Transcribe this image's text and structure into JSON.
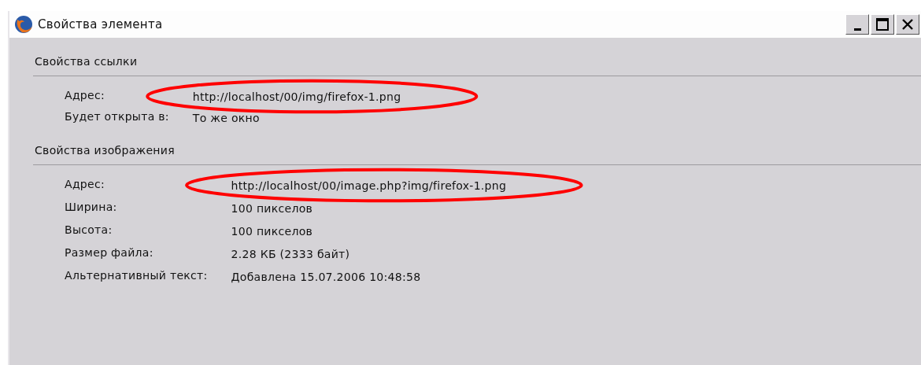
{
  "window": {
    "title": "Свойства элемента"
  },
  "sections": [
    {
      "title": "Свойства ссылки",
      "rows": [
        {
          "label": "Адрес:",
          "value": "http://localhost/00/img/firefox-1.png",
          "circled": true
        },
        {
          "label": "Будет открыта в:",
          "value": "То же окно",
          "circled": false
        }
      ]
    },
    {
      "title": "Свойства изображения",
      "rows": [
        {
          "label": "Адрес:",
          "value": "http://localhost/00/image.php?img/firefox-1.png",
          "circled": true
        },
        {
          "label": "Ширина:",
          "value": "100 пикселов",
          "circled": false
        },
        {
          "label": "Высота:",
          "value": "100 пикселов",
          "circled": false
        },
        {
          "label": "Размер файла:",
          "value": "2.28 КБ (2333 байт)",
          "circled": false
        },
        {
          "label": "Альтернативный текст:",
          "value": "Добавлена 15.07.2006 10:48:58",
          "circled": false
        }
      ]
    }
  ]
}
